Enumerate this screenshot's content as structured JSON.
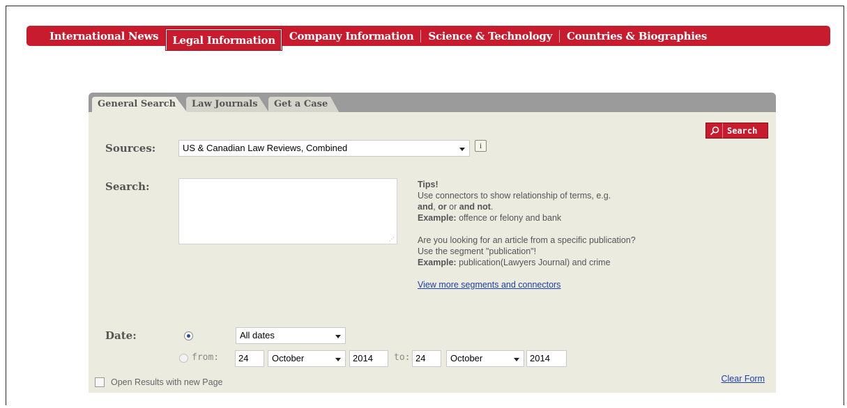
{
  "nav": {
    "items": [
      {
        "label": "International News"
      },
      {
        "label": "Legal Information"
      },
      {
        "label": "Company Information"
      },
      {
        "label": "Science & Technology"
      },
      {
        "label": "Countries & Biographies"
      }
    ],
    "active_index": 1,
    "color": "#c81b2e"
  },
  "tabs": [
    {
      "label": "General Search"
    },
    {
      "label": "Law Journals"
    },
    {
      "label": "Get a Case"
    }
  ],
  "search_button": {
    "label": "Search",
    "icon": "search-icon"
  },
  "sources": {
    "label": "Sources:",
    "value": "US & Canadian Law Reviews, Combined",
    "info_icon": "i"
  },
  "search": {
    "label": "Search:",
    "value": ""
  },
  "tips": {
    "title": "Tips!",
    "line1": "Use connectors to show relationship of terms, e.g.",
    "line2_and": "and",
    "line2_sep1": ", ",
    "line2_or": "or",
    "line2_mid": " or ",
    "line2_andnot": "and not",
    "line2_end": ".",
    "example_label": "Example:",
    "example1": " offence or felony and bank",
    "line3": "Are you looking for an article from a specific publication?",
    "line4": "Use the segment \"publication\"!",
    "example2": " publication(Lawyers Journal) and crime",
    "link": "View more segments and connectors"
  },
  "date": {
    "label": "Date:",
    "preset_value": "All dates",
    "from_label": "from:",
    "to_label": "to:",
    "from_day": "24",
    "from_month": "October",
    "from_year": "2014",
    "to_day": "24",
    "to_month": "October",
    "to_year": "2014"
  },
  "open_new_page": {
    "label": "Open Results with new Page",
    "checked": false
  },
  "clear_form": "Clear Form"
}
